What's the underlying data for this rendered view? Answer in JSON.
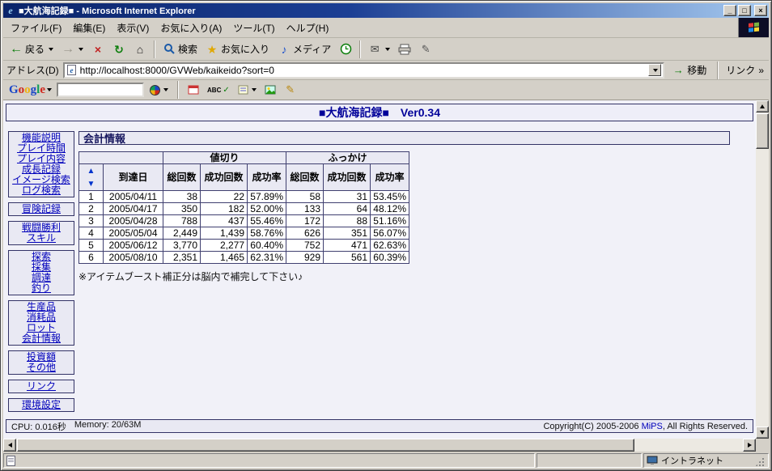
{
  "window": {
    "title": "■大航海記録■ - Microsoft Internet Explorer",
    "controls": {
      "minimize": "_",
      "maximize": "□",
      "close": "×"
    }
  },
  "menubar": {
    "items": [
      "ファイル(F)",
      "編集(E)",
      "表示(V)",
      "お気に入り(A)",
      "ツール(T)",
      "ヘルプ(H)"
    ]
  },
  "toolbar": {
    "back_label": "戻る",
    "search_label": "検索",
    "favorites_label": "お気に入り",
    "media_label": "メディア"
  },
  "addressbar": {
    "label": "アドレス(D)",
    "url": "http://localhost:8000/GVWeb/kaikeido?sort=0",
    "go_label": "移動",
    "links_label": "リンク",
    "links_chevron": "»"
  },
  "googlebar": {
    "logo_letters": [
      "G",
      "o",
      "o",
      "g",
      "l",
      "e"
    ],
    "search_value": "",
    "spellcheck_label": "ABC"
  },
  "icons": {
    "ie_e": "e",
    "back_arrow": "←",
    "forward_arrow": "→",
    "stop_x": "×",
    "refresh": "↻",
    "home": "⌂",
    "favorites_star": "★",
    "media_note": "♪",
    "mail_envelope": "✉",
    "edit_pencil": "✎",
    "go_arrow": "→",
    "check": "✓",
    "highlighter": "✎"
  },
  "page": {
    "title": "■大航海記録■　Ver0.34",
    "sidebar": {
      "groups": [
        [
          "機能説明",
          "プレイ時間",
          "プレイ内容",
          "成長記録",
          "イメージ検索",
          "ログ検索"
        ],
        [
          "冒険記録"
        ],
        [
          "戦闘勝利",
          "スキル"
        ],
        [
          "探索",
          "採集",
          "調達",
          "釣り"
        ],
        [
          "生産品",
          "消耗品",
          "ロット",
          "会計情報"
        ],
        [
          "投資額",
          "その他"
        ],
        [
          "リンク"
        ],
        [
          "環境設定"
        ]
      ]
    },
    "section_title": "会計情報",
    "table": {
      "sort_asc": "▲",
      "sort_desc": "▼",
      "date_header": "到達日",
      "group1": "値切り",
      "group2": "ふっかけ",
      "sub_total": "総回数",
      "sub_success": "成功回数",
      "sub_rate": "成功率",
      "rows": [
        {
          "no": "1",
          "date": "2005/04/11",
          "vt": "38",
          "vs": "22",
          "vr": "57.89%",
          "ft": "58",
          "fs": "31",
          "fr": "53.45%"
        },
        {
          "no": "2",
          "date": "2005/04/17",
          "vt": "350",
          "vs": "182",
          "vr": "52.00%",
          "ft": "133",
          "fs": "64",
          "fr": "48.12%"
        },
        {
          "no": "3",
          "date": "2005/04/28",
          "vt": "788",
          "vs": "437",
          "vr": "55.46%",
          "ft": "172",
          "fs": "88",
          "fr": "51.16%"
        },
        {
          "no": "4",
          "date": "2005/05/04",
          "vt": "2,449",
          "vs": "1,439",
          "vr": "58.76%",
          "ft": "626",
          "fs": "351",
          "fr": "56.07%"
        },
        {
          "no": "5",
          "date": "2005/06/12",
          "vt": "3,770",
          "vs": "2,277",
          "vr": "60.40%",
          "ft": "752",
          "fs": "471",
          "fr": "62.63%"
        },
        {
          "no": "6",
          "date": "2005/08/10",
          "vt": "2,351",
          "vs": "1,465",
          "vr": "62.31%",
          "ft": "929",
          "fs": "561",
          "fr": "60.39%"
        }
      ]
    },
    "note": "※アイテムブースト補正分は脳内で補完して下さい♪",
    "footer": {
      "cpu": "CPU: 0.016秒",
      "memory": "Memory: 20/63M",
      "copyright_prefix": "Copyright(C) 2005-2006 ",
      "copyright_link": "MiPS",
      "copyright_suffix": ", All Rights Reserved."
    }
  },
  "statusbar": {
    "zone": "イントラネット"
  },
  "colors": {
    "titlebar_left": "#0a246a",
    "titlebar_right": "#a6caf0",
    "chrome": "#d4d0c8",
    "page_bg": "#f1f1f8",
    "panel_bg": "#e9e9f3",
    "panel_border": "#333366",
    "link": "#0000bb",
    "page_title_text": "#000099"
  }
}
